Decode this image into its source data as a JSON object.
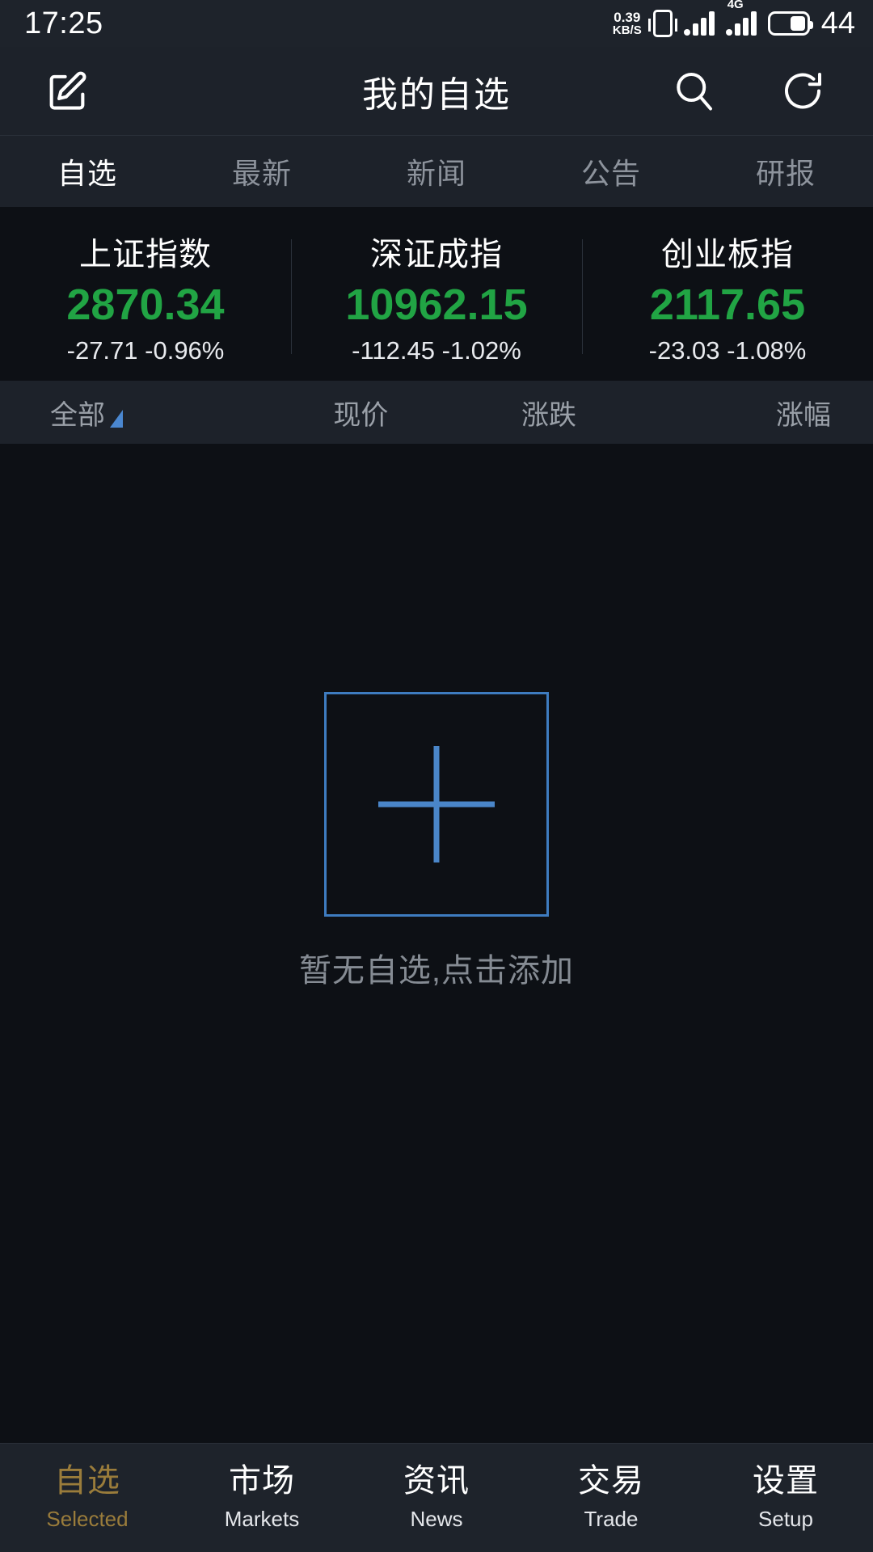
{
  "status_bar": {
    "time": "17:25",
    "net_speed_value": "0.39",
    "net_speed_unit": "KB/S",
    "vibrate_icon": "vibrate-icon",
    "signal1_icon": "signal-bars-icon",
    "network_type": "4G",
    "signal2_icon": "signal-bars-4g-icon",
    "battery_icon": "battery-icon",
    "battery_percent": "44"
  },
  "header": {
    "edit_icon": "edit-pencil-icon",
    "title": "我的自选",
    "search_icon": "search-icon",
    "refresh_icon": "refresh-icon"
  },
  "sub_tabs": [
    {
      "label": "自选",
      "active": true
    },
    {
      "label": "最新",
      "active": false
    },
    {
      "label": "新闻",
      "active": false
    },
    {
      "label": "公告",
      "active": false
    },
    {
      "label": "研报",
      "active": false
    }
  ],
  "indexes": [
    {
      "name": "上证指数",
      "price": "2870.34",
      "change": "-27.71 -0.96%",
      "color": "#21a444"
    },
    {
      "name": "深证成指",
      "price": "10962.15",
      "change": "-112.45 -1.02%",
      "color": "#21a444"
    },
    {
      "name": "创业板指",
      "price": "2117.65",
      "change": "-23.03 -1.08%",
      "color": "#21a444"
    }
  ],
  "column_header": {
    "filter_label": "全部",
    "sort_indicator_icon": "triangle-sort-icon",
    "col_price": "现价",
    "col_change": "涨跌",
    "col_percent": "涨幅"
  },
  "empty_state": {
    "add_icon": "plus-box-icon",
    "message": "暂无自选,点击添加"
  },
  "bottom_nav": [
    {
      "cn": "自选",
      "en": "Selected",
      "active": true
    },
    {
      "cn": "市场",
      "en": "Markets",
      "active": false
    },
    {
      "cn": "资讯",
      "en": "News",
      "active": false
    },
    {
      "cn": "交易",
      "en": "Trade",
      "active": false
    },
    {
      "cn": "设置",
      "en": "Setup",
      "active": false
    }
  ],
  "colors": {
    "background": "#0d1015",
    "panel": "#1d222a",
    "status_bar": "#1e232b",
    "accent_blue": "#4a86c9",
    "down_green": "#21a444",
    "active_gold": "#9a7c3b",
    "muted_text": "#8d939c"
  }
}
